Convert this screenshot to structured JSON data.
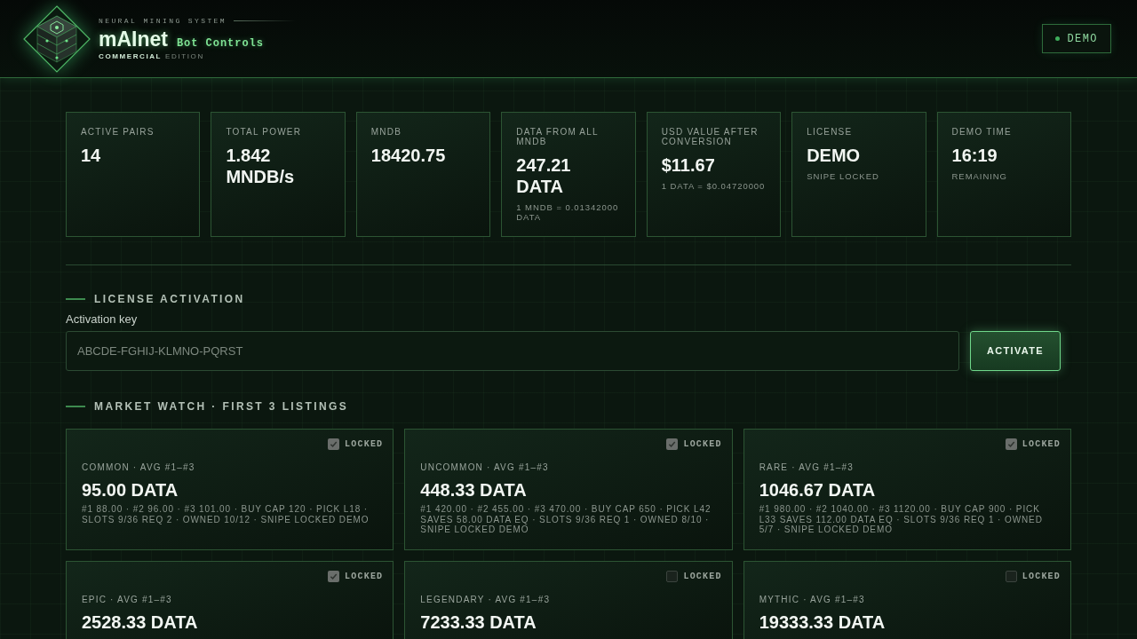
{
  "header": {
    "tagline": "NEURAL MINING SYSTEM",
    "brand": "mAInet",
    "subtitle": "Bot Controls",
    "edition_highlight": "COMMERCIAL",
    "edition": "EDITION",
    "badge": {
      "label": "DEMO"
    }
  },
  "stats": [
    {
      "label": "ACTIVE PAIRS",
      "value": "14"
    },
    {
      "label": "TOTAL POWER",
      "value": "1.842 MNDB/s"
    },
    {
      "label": "MNDB",
      "value": "18420.75"
    },
    {
      "label": "DATA FROM ALL MNDB",
      "value": "247.21 DATA",
      "note": "1 MNDB = 0.01342000 DATA"
    },
    {
      "label": "USD VALUE AFTER CONVERSION",
      "value": "$11.67",
      "note": "1 DATA = $0.04720000"
    },
    {
      "label": "LICENSE",
      "value": "DEMO",
      "note": "SNIPE LOCKED"
    },
    {
      "label": "DEMO TIME",
      "value": "16:19",
      "note": "REMAINING"
    }
  ],
  "license_activation": {
    "title": "LICENSE ACTIVATION",
    "field_label": "Activation key",
    "placeholder": "ABCDE-FGHIJ-KLMNO-PQRST",
    "button": "ACTIVATE"
  },
  "market_watch": {
    "title": "MARKET WATCH · FIRST 3 LISTINGS",
    "listings": [
      {
        "lock_label": "LOCKED",
        "locked": true,
        "tier": "COMMON · AVG #1–#3",
        "price": "95.00 DATA",
        "details": "#1 88.00 · #2 96.00 · #3 101.00 · BUY CAP 120 · PICK L18 · SLOTS 9/36 REQ 2 · OWNED 10/12 · SNIPE LOCKED DEMO"
      },
      {
        "lock_label": "LOCKED",
        "locked": true,
        "tier": "UNCOMMON · AVG #1–#3",
        "price": "448.33 DATA",
        "details": "#1 420.00 · #2 455.00 · #3 470.00 · BUY CAP 650 · PICK L42 SAVES 58.00 DATA EQ · SLOTS 9/36 REQ 1 · OWNED 8/10 · SNIPE LOCKED DEMO"
      },
      {
        "lock_label": "LOCKED",
        "locked": true,
        "tier": "RARE · AVG #1–#3",
        "price": "1046.67 DATA",
        "details": "#1 980.00 · #2 1040.00 · #3 1120.00 · BUY CAP 900 · PICK L33 SAVES 112.00 DATA EQ · SLOTS 9/36 REQ 1 · OWNED 5/7 · SNIPE LOCKED DEMO"
      },
      {
        "lock_label": "LOCKED",
        "locked": true,
        "tier": "EPIC · AVG #1–#3",
        "price": "2528.33 DATA"
      },
      {
        "lock_label": "LOCKED",
        "locked": false,
        "tier": "LEGENDARY · AVG #1–#3",
        "price": "7233.33 DATA"
      },
      {
        "lock_label": "LOCKED",
        "locked": false,
        "tier": "MYTHIC · AVG #1–#3",
        "price": "19333.33 DATA"
      }
    ]
  }
}
